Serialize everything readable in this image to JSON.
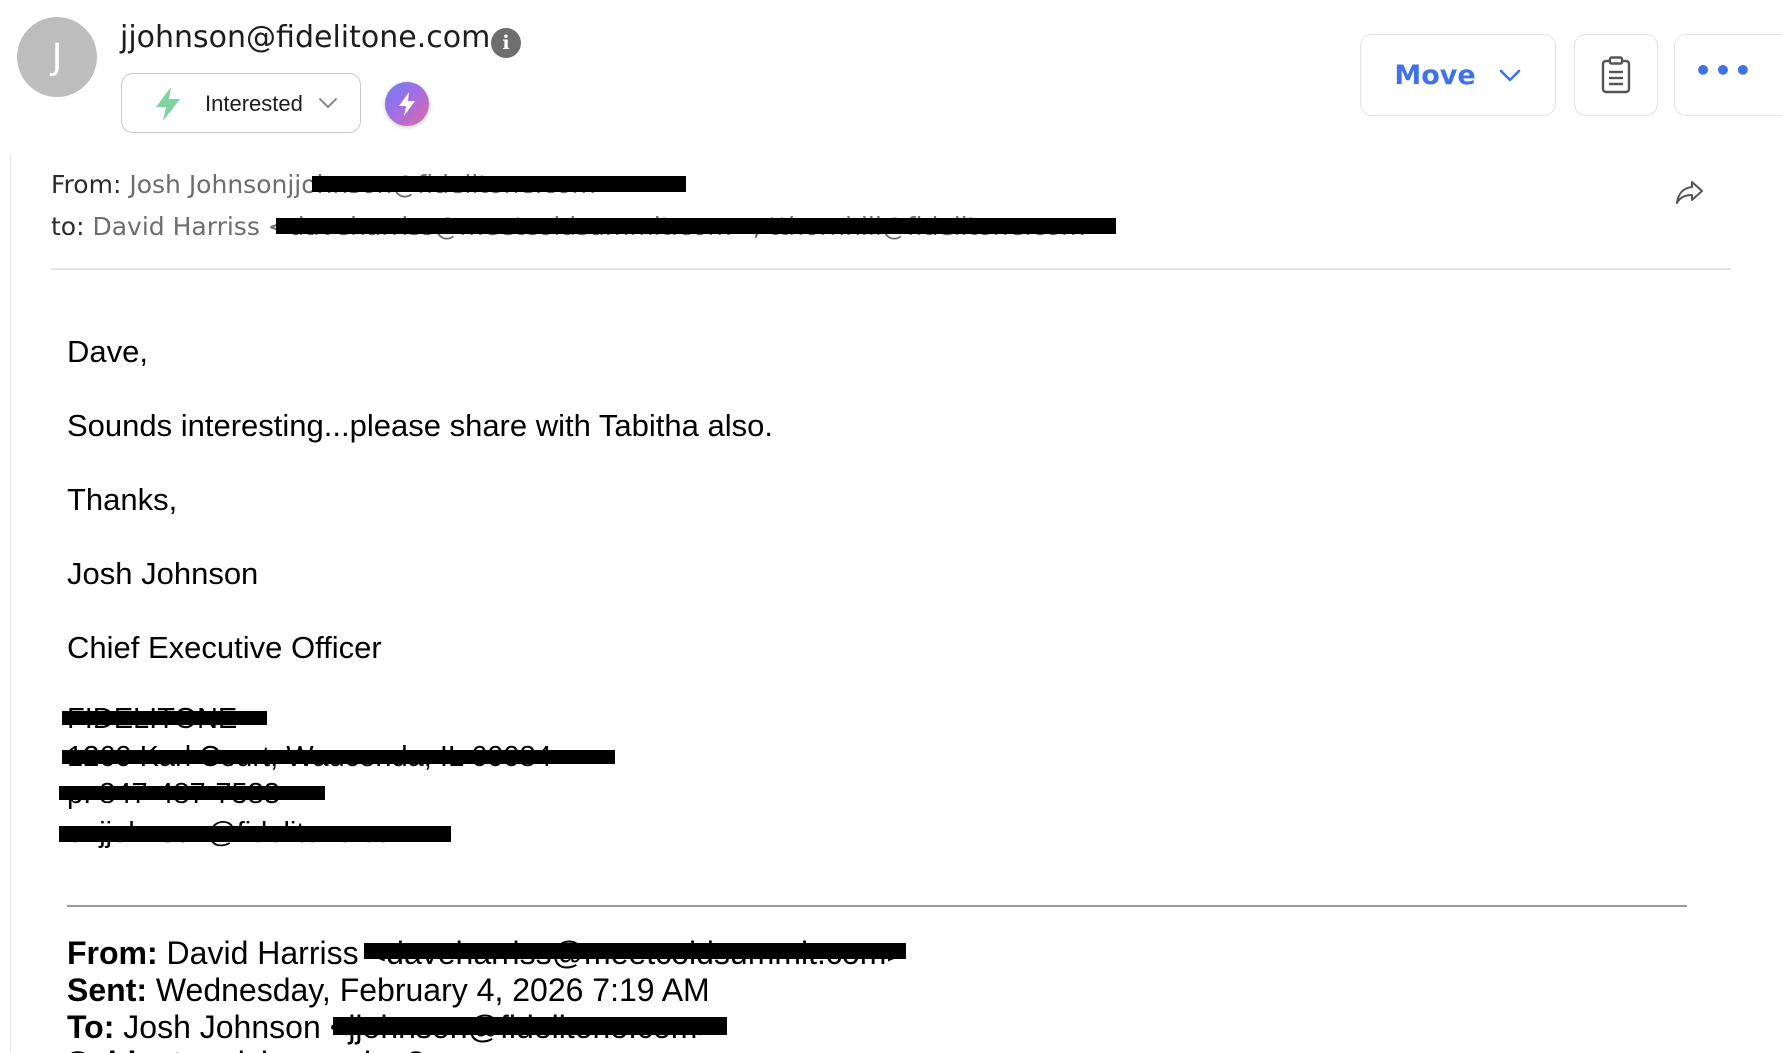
{
  "header": {
    "avatar_initial": "J",
    "sender_email": "jjohnson@fidelitone.com",
    "status_label": "Interested",
    "move_label": "Move",
    "more_label": "•••"
  },
  "message": {
    "from_prefix": "From:",
    "from_name": "Josh Johnson",
    "from_email": "jjohnson@fidelitone.com",
    "to_prefix": "to:",
    "to_name": "David Harriss",
    "to_email": "<daveharriss@meetcoldsummit.com>, tthornhill@fidelitone.com"
  },
  "body": {
    "greeting": "Dave,",
    "line1": "Sounds interesting...please share with Tabitha also.",
    "thanks": "Thanks,",
    "signature_name": "Josh Johnson",
    "signature_title": "Chief Executive Officer"
  },
  "signature_block": {
    "company": "FIDELITONE",
    "address": "1260 Karl Court, Wauconda, IL 60084",
    "phone": "p: 847-487-7583",
    "email": "e: jjohnson@fidelitone.com"
  },
  "quoted": {
    "from_label": "From:",
    "from_value": "David Harriss",
    "from_email": "<daveharriss@meetcoldsummit.com>",
    "sent_label": "Sent:",
    "sent_value": "Wednesday, February 4, 2026 7:19 AM",
    "to_label": "To:",
    "to_value": "Josh Johnson",
    "to_email": "<jjohnson@fidelitone.com>",
    "subject_label": "Subject:",
    "subject_value": "quick question?"
  },
  "colors": {
    "accent": "#3f72e8",
    "status_bolt": "#7ed3a0",
    "redaction": "#000000"
  }
}
